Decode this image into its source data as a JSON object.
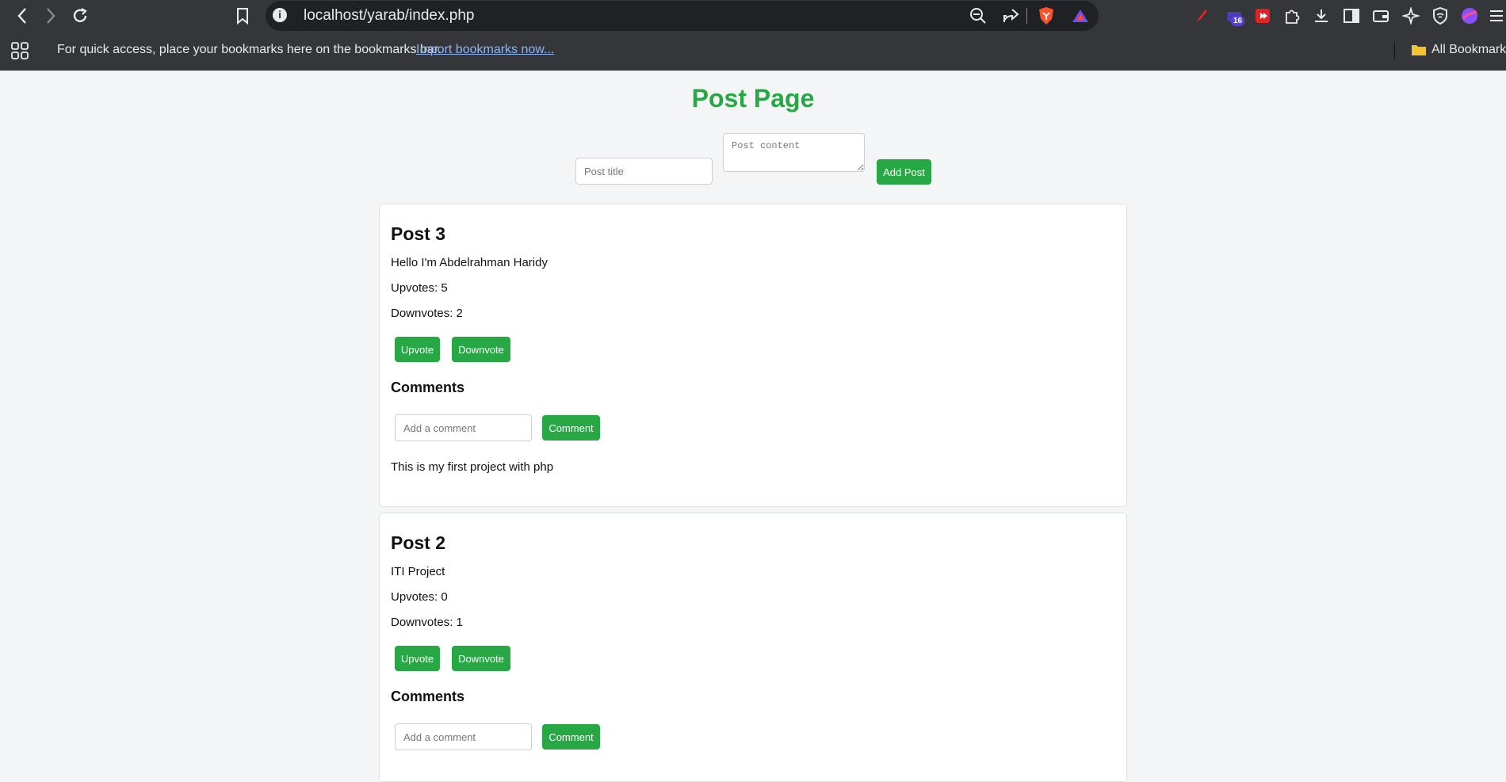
{
  "browser": {
    "url": "localhost/yarab/index.php",
    "extension_badge": "16",
    "bookmarks_bar": {
      "message": "For quick access, place your bookmarks here on the bookmarks bar.",
      "import_link": "Import bookmarks now...",
      "all_bookmarks": "All Bookmarks"
    }
  },
  "page": {
    "title": "Post Page",
    "form": {
      "title_placeholder": "Post title",
      "content_placeholder": "Post content",
      "add_button": "Add Post"
    },
    "posts": [
      {
        "title": "Post 3",
        "content": "Hello I'm Abdelrahman Haridy",
        "upvotes": "Upvotes: 5",
        "downvotes": "Downvotes: 2",
        "upvote_button": "Upvote",
        "downvote_button": "Downvote",
        "comments_heading": "Comments",
        "comment_placeholder": "Add a comment",
        "comment_button": "Comment",
        "comments": [
          "This is my first project with php"
        ]
      },
      {
        "title": "Post 2",
        "content": "ITI Project",
        "upvotes": "Upvotes: 0",
        "downvotes": "Downvotes: 1",
        "upvote_button": "Upvote",
        "downvote_button": "Downvote",
        "comments_heading": "Comments",
        "comment_placeholder": "Add a comment",
        "comment_button": "Comment",
        "comments": []
      }
    ]
  },
  "colors": {
    "accent": "#28a745",
    "chrome_bg": "#35363a",
    "page_bg": "#f4f5f7"
  }
}
